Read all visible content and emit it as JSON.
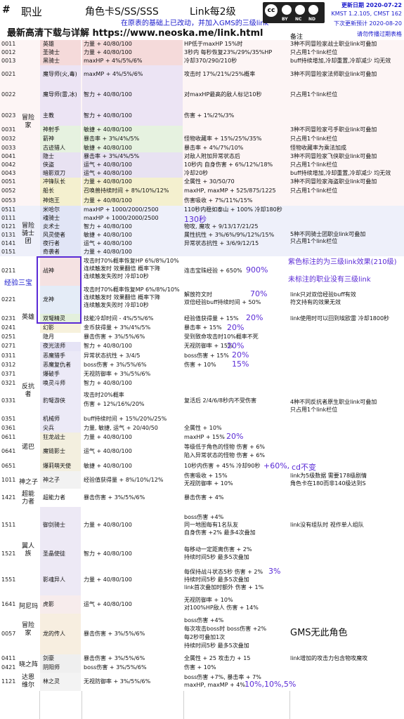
{
  "header": {
    "col_hash": "#",
    "col_job": "职业",
    "col_card": "角色卡S/SS/SSS",
    "col_link": "Link每2级",
    "subtitle_line1": "在原表的基础上已改动，并加入GMS的三级link",
    "download": "最新高清下载与详解 https://www.neoska.me/link.html",
    "updated": "更新日期 2020-07-22",
    "version": "KMST 1.2.105, CMST 162",
    "next_update": "下次更新预计 2020-08-20",
    "notice": "请勿传播过期表格",
    "remark_header": "备注",
    "license": [
      "BY",
      "NC",
      "ND"
    ]
  },
  "colors": {
    "accent": "#5a2ad6",
    "blue": "#1a1acc",
    "adventurer": "#fdf0f0",
    "highlight_border": "#5a2ad6"
  },
  "class_groups": [
    {
      "name": "冒险家"
    },
    {
      "name": "冒险骑士团"
    },
    {
      "name": "英雄"
    },
    {
      "name": "反抗者"
    },
    {
      "name": "诺巴"
    },
    {
      "name": "神之子"
    },
    {
      "name": "超能力者"
    },
    {
      "name": "翼人族"
    },
    {
      "name": "阿尼玛"
    },
    {
      "name": "冒险家"
    },
    {
      "name": "晓之阵"
    },
    {
      "name": "达恩维尔"
    }
  ],
  "rows": [
    {
      "code": "0011",
      "job": "英雄",
      "card": "力量 + 40/80/100",
      "link": "HP低于maxHP 15%时",
      "note": "3种不同冒险家战士职业link可叠加",
      "bg": "#f5dada"
    },
    {
      "code": "0012",
      "job": "圣骑士",
      "card": "力量 + 40/80/100",
      "link": "3秒内 每秒恢复23%/29%/35%HP",
      "note": "只占用1个link栏位",
      "bg": "#f5dada"
    },
    {
      "code": "0013",
      "job": "黑骑士",
      "card": "maxHP + 4%/5%/6%",
      "link": "冷却370/290/210秒",
      "note": "buff持续增加,冷却重置,冷却减少 均无效",
      "bg": "#f5dada"
    },
    {
      "code": "0021",
      "job": "魔导师(火,毒)",
      "card": "maxMP + 4%/5%/6%",
      "link": "攻击时 17%/21%/25%概率",
      "note": "3种不同冒险家法师职业link可叠加",
      "bg": "#ece4f4"
    },
    {
      "code": "0022",
      "job": "魔导师(雷,冰)",
      "card": "智力 + 40/80/100",
      "link": "对maxHP最高的敌人标记10秒",
      "note": "只占用1个link栏位",
      "bg": "#ece4f4"
    },
    {
      "code": "0023",
      "job": "主教",
      "card": "智力 + 40/80/100",
      "link": "伤害 + 1%/2%/3%",
      "note": "",
      "bg": "#ece4f4"
    },
    {
      "code": "0031",
      "job": "神射手",
      "card": "敏捷 + 40/80/100",
      "link": "",
      "note": "3种不同冒险家弓手职业link可叠加",
      "bg": "#e6f2e0"
    },
    {
      "code": "0032",
      "job": "箭神",
      "card": "暴击率 + 3%/4%/5%",
      "link": "怪物收藏率 + 15%/25%/35%",
      "note": "只占用1个link栏位",
      "bg": "#e6f2e0"
    },
    {
      "code": "0033",
      "job": "古迹猎人",
      "card": "敏捷 + 40/80/100",
      "link": "暴击率 + 4%/7%/10%",
      "note": "怪物收藏率为乘法加成",
      "bg": "#e6f2e0"
    },
    {
      "code": "0041",
      "job": "隐士",
      "card": "暴击率 + 3%/4%/5%",
      "link": "对敌人附加异常状态后",
      "note": "3种不同冒险家飞侠职业link可叠加",
      "bg": "#e8e2f2"
    },
    {
      "code": "0042",
      "job": "侠盗",
      "card": "运气 + 40/80/100",
      "link": "10秒内 自身伤害 + 6%/12%/18%",
      "note": "只占用1个link栏位",
      "bg": "#e8e2f2"
    },
    {
      "code": "0043",
      "job": "暗影双刀",
      "card": "运气 + 40/80/100",
      "link": "冷却20秒",
      "note": "buff持续增加,冷却重置,冷却减少 均无效",
      "bg": "#e8e2f2"
    },
    {
      "code": "0051",
      "job": "冲锋队长",
      "card": "力量 + 40/80/100",
      "link": "全属性 + 30/50/70",
      "note": "3种不同冒险家海盗职业link可叠加",
      "bg": "#f4f0cf"
    },
    {
      "code": "0052",
      "job": "船长",
      "card": "召唤兽持续时间 + 8%/10%/12%",
      "link": "maxHP, maxMP + 525/875/1225",
      "note": "只占用1个link栏位",
      "bg": "#f4f0cf"
    },
    {
      "code": "0053",
      "job": "神炮王",
      "card": "力量 + 40/80/100",
      "link": "伤害吸收 + 7%/11%/15%",
      "note": "",
      "bg": "#f4f0cf"
    }
  ],
  "rows2": [
    {
      "code": "0511",
      "job": "米哈尔",
      "card": "maxHP + 1000/2000/2500",
      "link": "110秒内稳如泰山 + 100% 冷却180秒",
      "bg": "#e1e5f6"
    },
    {
      "code": "0111",
      "job": "魂骑士",
      "card": "maxHP + 1000/2000/2500",
      "link": "",
      "bg": "#e1e5f6"
    },
    {
      "code": "0121",
      "job": "炎术士",
      "card": "智力 + 40/80/100",
      "link": "物攻, 魔攻 + 9/13/17/21/25",
      "bg": "#e1e5f6"
    },
    {
      "code": "0131",
      "job": "风灵使者",
      "card": "敏捷 + 40/80/100",
      "link": "属性抗性 + 3%/6%/9%/12%/15%",
      "bg": "#e1e5f6"
    },
    {
      "code": "0141",
      "job": "夜行者",
      "card": "运气 + 40/80/100",
      "link": "异常状态抗性 + 3/6/9/12/15",
      "bg": "#e1e5f6"
    },
    {
      "code": "0151",
      "job": "奇袭者",
      "card": "力量 + 40/80/100",
      "link": "",
      "bg": "#e1e5f6"
    }
  ],
  "knights": {
    "seconds": "130秒",
    "note1": "5种不同骑士团职业link可叠加",
    "note2": "只占用1个link栏位"
  },
  "heroes": {
    "label_outer": "经验三宝",
    "aran_code": "0211",
    "aran_job": "战神",
    "aran_card1": "攻击时70%概率恢复HP 6%/8%/10%",
    "aran_card2": "连续触发时 效果翻倍 概率下降",
    "aran_card3": "连续触发失败时 冷却10秒",
    "aran_link": "连击宝珠经验 + 650%",
    "aran_link_val": "900%",
    "evan_code": "0221",
    "evan_job": "龙神",
    "evan_card1": "攻击时70%概率恢复MP 6%/8%/10%",
    "evan_card2": "连续触发时 效果翻倍 概率下降",
    "evan_card3": "连续触发失败时 冷却10秒",
    "evan_link1": "解放符文时",
    "evan_link1_val": "70%",
    "evan_link2": "双倍经验buff持续时间 + 50%",
    "evan_note1": "link只对双倍经验buff有效",
    "evan_note2": "符文持有的效果无效",
    "mercedes_code": "0231",
    "mercedes_job": "双弩精灵",
    "mercedes_card": "技能冷却时间 - 4%/5%/6%",
    "mercedes_link": "经验值获得量 + 15%",
    "mercedes_link_val": "20%",
    "mercedes_note": "link使用时可以回到埃欧雷 冷却1800秒",
    "ann1": "紫色标注的为三级link效果(210级)",
    "ann2": "未标注的职业没有三级link",
    "phantom_code": "0241",
    "phantom_job": "幻影",
    "phantom_card": "金币获得量 + 3%/4%/5%",
    "phantom_link": "暴击率 + 15%",
    "phantom_val": "20%",
    "eunwol_code": "0251",
    "eunwol_job": "隐月",
    "eunwol_card": "暴击伤害 + 3%/5%/6%",
    "eunwol_link": "受到致命攻击时10%概率不死",
    "luminous_code": "0271",
    "luminous_job": "夜光法师",
    "luminous_card": "智力 + 40/80/100",
    "luminous_link": "无视防御率 + 15%",
    "luminous_val": "20%"
  },
  "resistance": [
    {
      "code": "0311",
      "job": "恶魔猎手",
      "card": "异常状态抗性 + 3/4/5",
      "link": "boss伤害 + 15%",
      "val": "20%"
    },
    {
      "code": "0312",
      "job": "恶魔复仇者",
      "card": "boss伤害 + 3%/5%/6%",
      "link": "伤害 + 10%",
      "val": "15%"
    },
    {
      "code": "0371",
      "job": "爆破手",
      "card": "无视防御率 + 3%/5%/6%",
      "link": "",
      "val": ""
    },
    {
      "code": "0321",
      "job": "唤灵斗师",
      "card": "智力 + 40/80/100",
      "link": "",
      "val": ""
    },
    {
      "code": "0331",
      "job": "豹弩游侠",
      "card": "攻击时20%概率",
      "link": "复活后 2/4/6/8秒内不受伤害",
      "val": ""
    },
    {
      "code": "0351",
      "job": "机械师",
      "card": "buff持续时间 + 15%/20%/25%",
      "link": "",
      "val": ""
    },
    {
      "code": "0361",
      "job": "尖兵",
      "card": "力量, 敏捷, 运气 + 20/40/50",
      "link": "全属性 + 10%",
      "val": ""
    }
  ],
  "resistance_extra": {
    "card2": "伤害 + 12%/16%/20%",
    "note1": "4种不同反抗者原生职业link可叠加",
    "note2": "只占用1个link栏位"
  },
  "nova": [
    {
      "code": "0611",
      "job": "狂龙战士",
      "card": "力量 + 40/80/100",
      "link": "maxHP + 15%",
      "val": "20%"
    },
    {
      "code": "0641",
      "job": "魔链影士",
      "card": "运气 + 40/80/100",
      "link": "等级低于角色的怪物 伤害 + 6%",
      "link2": "陷入异常状态的怪物 伤害 + 6%",
      "val": ""
    },
    {
      "code": "0651",
      "job": "爆莉萌天使",
      "card": "敏捷 + 40/80/100",
      "link": "10秒内伤害 + 45% 冷却90秒",
      "val": "+60%,",
      "val2": "cd不变"
    }
  ],
  "zero": {
    "code": "1011",
    "group": "神之子",
    "job": "神之子",
    "card": "经验值获得量 + 8%/10%/12%",
    "link1": "伤害吸收 + 15%",
    "link2": "无视防御率 + 10%",
    "note1": "link为5级数据 需要178级剧情",
    "note2": "角色卡在180而非140级达到S"
  },
  "kinesis": {
    "code": "1421",
    "group": "超能力者",
    "job": "超能力者",
    "card": "暴击伤害 + 3%/5%/6%",
    "link": "暴击伤害 + 4%"
  },
  "flora": [
    {
      "code": "1511",
      "job": "御剑骑士",
      "card": "力量 + 40/80/100",
      "link1": "boss伤害 +4%",
      "link2": "同一地图每有1名队友",
      "link3": "自身伤害 +2% 最多4次叠加",
      "note": "link没有组队时 视作单人组队"
    },
    {
      "code": "1521",
      "job": "圣晶使徒",
      "card": "智力 + 40/80/100",
      "link1": "每移动一定距离伤害 + 2%",
      "link2": "持续时间5秒 最多5次叠加"
    },
    {
      "code": "1551",
      "job": "影魂异人",
      "card": "力量 + 40/80/100",
      "link1": "每保持战斗状态5秒 伤害 + 2%",
      "link2": "持续时间5秒 最多5次叠加",
      "link3": "link首次叠加时额外 伤害 + 1%",
      "val": "3%"
    }
  ],
  "anima": {
    "code": "1641",
    "group": "阿尼玛",
    "job": "虎影",
    "card": "运气 + 40/80/100",
    "link1": "无视防御率 + 10%",
    "link2": "对100%HP敌人 伤害 + 14%"
  },
  "gms": {
    "code": "0057",
    "group": "冒险家",
    "job": "龙的传人",
    "card": "暴击伤害 + 3%/5%/6%",
    "link1": "boss伤害 +4%",
    "link2": "每次攻击boss时 boss伤害 +2%",
    "link3": "每2秒可叠加1次",
    "link4": "持续时间5秒 最多5次叠加",
    "note": "GMS无此角色"
  },
  "sengoku": [
    {
      "code": "0411",
      "job": "剑豪",
      "card": "暴击伤害 + 3%/5%/6%",
      "link": "全属性 + 25 攻击力 + 15",
      "note": "link增加的攻击力包含物攻魔攻"
    },
    {
      "code": "0421",
      "job": "阴阳师",
      "card": "boss伤害 + 3%/5%/6%",
      "link": "伤害 + 10%"
    }
  ],
  "illium": {
    "code": "1121",
    "group": "达恩维尔",
    "job": "林之灵",
    "card": "无视防御率 + 3%/5%/6%",
    "link1": "boss伤害 +7%, 暴击率 + 7%",
    "link2": "maxHP, maxMP + 4%",
    "val": "10%,10%,5%"
  }
}
